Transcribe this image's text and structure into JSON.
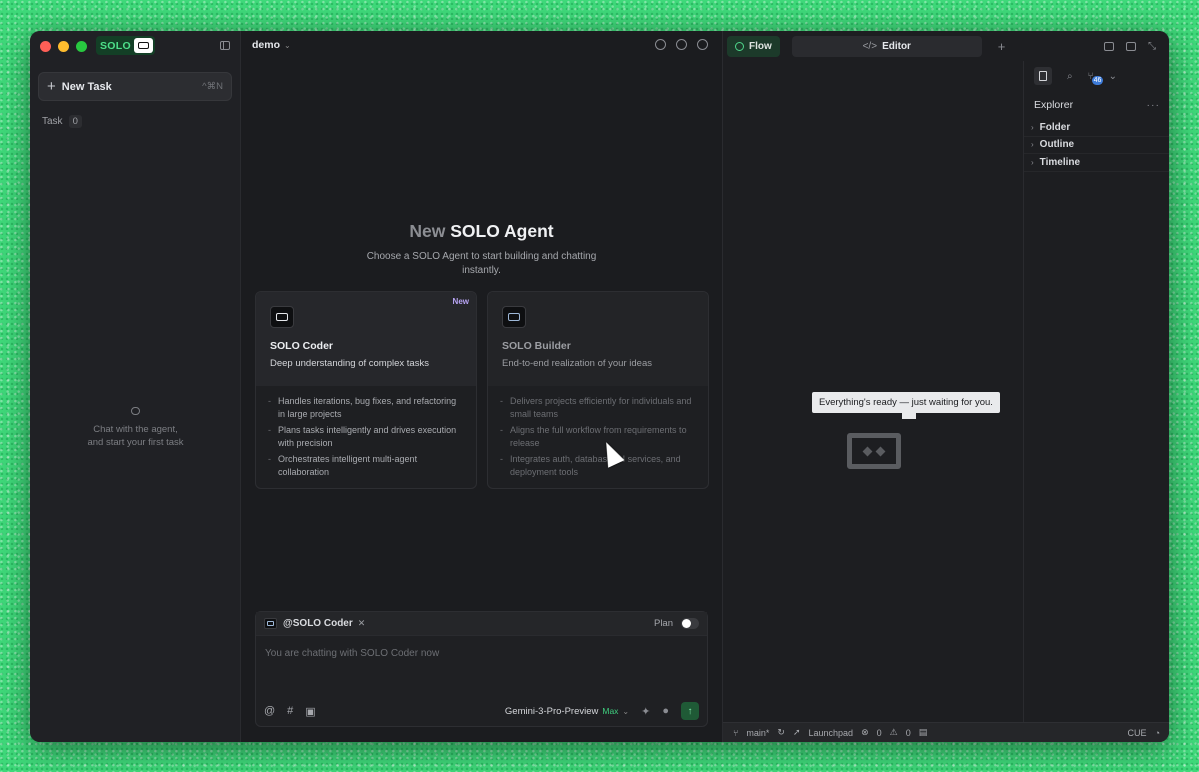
{
  "sidebar": {
    "logo_text": "SOLO",
    "new_task_label": "New Task",
    "new_task_shortcut": "^⌘N",
    "task_label": "Task",
    "task_count": "0",
    "empty_line1": "Chat with the agent,",
    "empty_line2": "and start your first task"
  },
  "header": {
    "project": "demo"
  },
  "hero": {
    "title_dim": "New",
    "title_main": "SOLO Agent",
    "subtitle": "Choose a SOLO Agent to start building and chatting instantly."
  },
  "cards": [
    {
      "title": "SOLO Coder",
      "badge": "New",
      "desc": "Deep understanding of complex tasks",
      "bullets": [
        "Handles iterations, bug fixes, and refactoring in large projects",
        "Plans tasks intelligently and drives execution with precision",
        "Orchestrates intelligent multi-agent collaboration"
      ]
    },
    {
      "title": "SOLO Builder",
      "desc": "End-to-end realization of your ideas",
      "bullets": [
        "Delivers projects efficiently for individuals and small teams",
        "Aligns the full workflow from requirements to release",
        "Integrates auth, database, AI services, and deployment tools"
      ]
    }
  ],
  "chat": {
    "agent_label": "@SOLO Coder",
    "plan_label": "Plan",
    "placeholder": "You are chatting with SOLO Coder now",
    "model": "Gemini-3-Pro-Preview",
    "model_tier": "Max"
  },
  "right": {
    "tab_flow": "Flow",
    "tab_editor": "Editor",
    "tooltip": "Everything's ready — just waiting for you.",
    "explorer_title": "Explorer",
    "scm_badge": "46",
    "tree": [
      "Folder",
      "Outline",
      "Timeline"
    ],
    "status": {
      "branch": "main*",
      "launchpad": "Launchpad",
      "errors": "0",
      "warnings": "0",
      "cue": "CUE"
    }
  },
  "colors": {
    "accent_green": "#3fcf7f",
    "badge_purple": "#b8a4f4",
    "background": "#1b1c1f"
  }
}
